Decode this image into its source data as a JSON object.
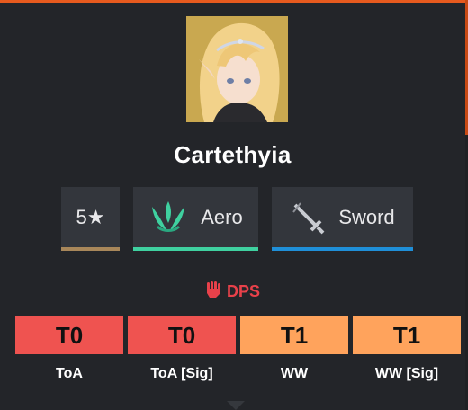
{
  "character": {
    "name": "Cartethyia",
    "rarity": "5★",
    "element": "Aero",
    "weapon": "Sword",
    "role": "DPS"
  },
  "tiers": [
    {
      "value": "T0",
      "label": "ToA",
      "color": "#ef5350"
    },
    {
      "value": "T0",
      "label": "ToA [Sig]",
      "color": "#ef5350"
    },
    {
      "value": "T1",
      "label": "WW",
      "color": "#ffa35c"
    },
    {
      "value": "T1",
      "label": "WW [Sig]",
      "color": "#ffa35c"
    }
  ],
  "colors": {
    "rarity_bar": "#a8875a",
    "element_bar": "#3fd1a0",
    "weapon_bar": "#1f8fd8",
    "role": "#e8414a",
    "accent_top": "#e65a1e"
  },
  "icons": {
    "element": "aero-icon",
    "weapon": "sword-icon",
    "role": "fist-icon"
  }
}
